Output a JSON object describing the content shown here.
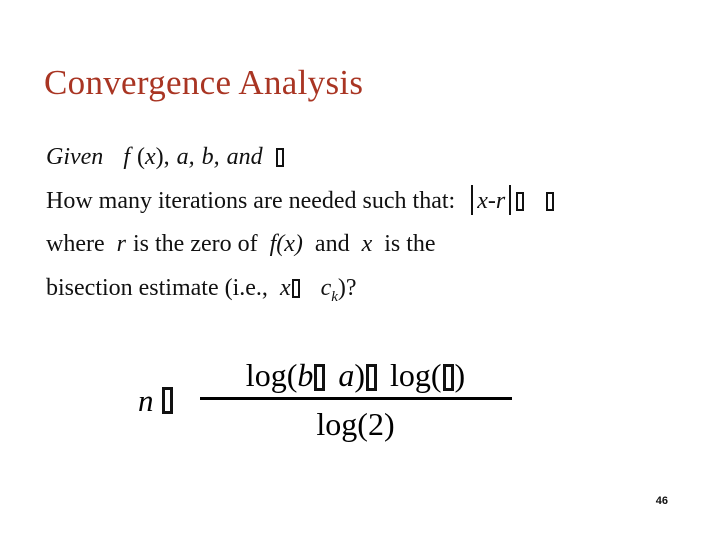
{
  "slide": {
    "title": "Convergence Analysis",
    "title_color": "#A93523",
    "background_color": "#ffffff",
    "page_number": "46"
  },
  "body": {
    "line1": {
      "given_label": "Given",
      "function": "f",
      "arg_open": "(",
      "arg_var": "x",
      "arg_close": "),",
      "param_a": "a,",
      "param_b": "b,",
      "and_label": "and",
      "missing_symbol": "tofu-box"
    },
    "line2": {
      "question": "How many iterations are needed such that:",
      "expr_x": "x",
      "expr_minus": "-",
      "expr_r": "r",
      "missing_relation": "tofu-box",
      "missing_epsilon": "tofu-box"
    },
    "line3": {
      "where_label": "where",
      "var_r": "r",
      "is_the_zero_of": "is  the  zero  of",
      "function": "f(x)",
      "and_label": "and",
      "var_x": "x",
      "is_the": "is  the"
    },
    "line4": {
      "text_prefix": "bisection  estimate  (i.e.,",
      "var_x": "x",
      "missing_relation": "tofu-box",
      "var_c": "c",
      "sub_k": "k",
      "text_suffix": ")?"
    }
  },
  "formula": {
    "lhs_var": "n",
    "lhs_missing_relation": "tofu-box",
    "numerator_log_open": "log(",
    "numerator_b": "b",
    "numerator_missing_minus": "tofu-box",
    "numerator_a": "a",
    "numerator_close": ")",
    "numerator_missing_op": "tofu-box",
    "numerator_log2_open": "log(",
    "numerator_missing_epsilon": "tofu-box",
    "numerator_log2_close": ")",
    "denominator": "log(2)"
  }
}
